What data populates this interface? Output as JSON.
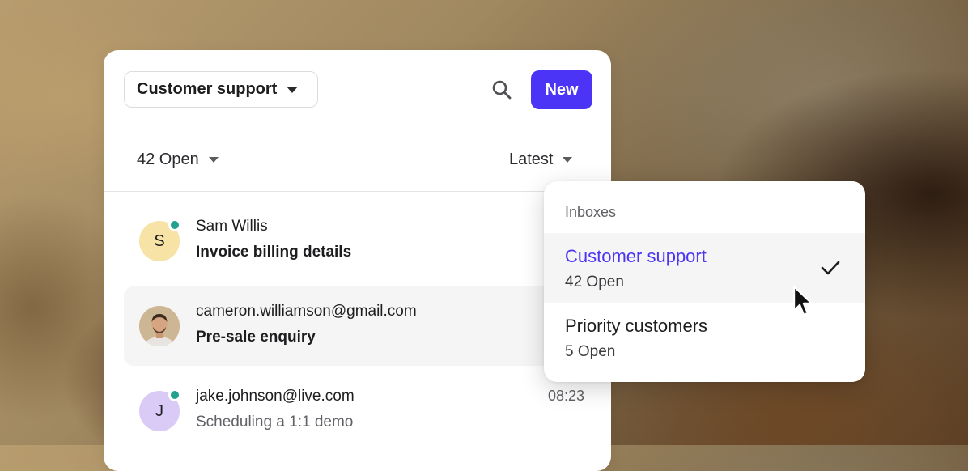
{
  "header": {
    "inbox_label": "Customer support",
    "new_label": "New"
  },
  "filters": {
    "open_label": "42 Open",
    "sort_label": "Latest"
  },
  "conversations": [
    {
      "name": "Sam Willis",
      "subject": "Invoice billing details",
      "avatar_initial": "S",
      "avatar_color": "#f7e3a6",
      "online": true,
      "time": ""
    },
    {
      "name": "cameron.williamson@gmail.com",
      "subject": "Pre-sale enquiry",
      "avatar_initial": "",
      "avatar_color": "#d9c2a4",
      "online": false,
      "time": ""
    },
    {
      "name": "jake.johnson@live.com",
      "subject": "Scheduling a 1:1 demo",
      "avatar_initial": "J",
      "avatar_color": "#d9cbf5",
      "online": true,
      "time": "08:23"
    }
  ],
  "dropdown": {
    "title": "Inboxes",
    "options": [
      {
        "name": "Customer support",
        "count": "42 Open",
        "selected": true
      },
      {
        "name": "Priority customers",
        "count": "5 Open",
        "selected": false
      }
    ]
  },
  "colors": {
    "accent": "#4b34f5",
    "online": "#22a18e"
  },
  "icons": {
    "search": "search-icon",
    "check": "check-icon",
    "cursor": "cursor-icon"
  }
}
